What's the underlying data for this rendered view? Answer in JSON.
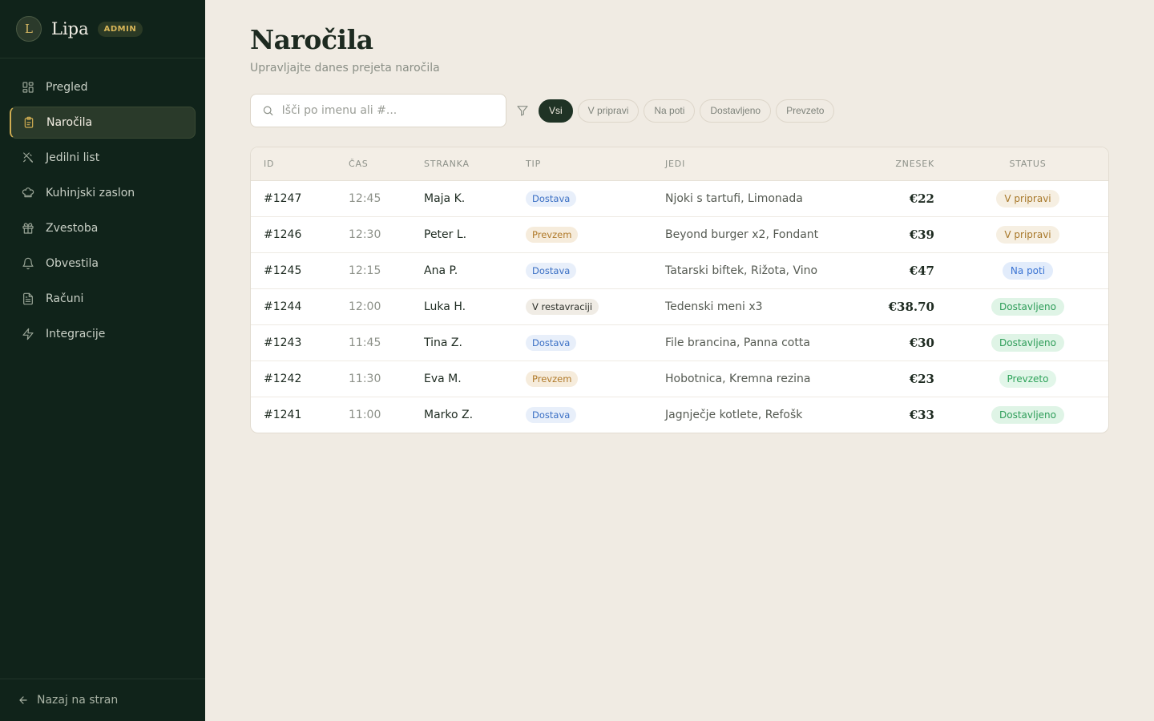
{
  "brand": {
    "initial": "L",
    "name": "Lipa",
    "badge": "ADMIN"
  },
  "nav": [
    {
      "label": "Pregled",
      "icon": "grid-icon",
      "active": false
    },
    {
      "label": "Naročila",
      "icon": "clipboard-icon",
      "active": true
    },
    {
      "label": "Jedilni list",
      "icon": "utensils-icon",
      "active": false
    },
    {
      "label": "Kuhinjski zaslon",
      "icon": "chef-hat-icon",
      "active": false
    },
    {
      "label": "Zvestoba",
      "icon": "gift-icon",
      "active": false
    },
    {
      "label": "Obvestila",
      "icon": "bell-icon",
      "active": false
    },
    {
      "label": "Računi",
      "icon": "receipt-icon",
      "active": false
    },
    {
      "label": "Integracije",
      "icon": "lightning-icon",
      "active": false
    }
  ],
  "footer": {
    "back_label": "Nazaj na stran"
  },
  "page": {
    "title": "Naročila",
    "subtitle": "Upravljajte danes prejeta naročila"
  },
  "search": {
    "placeholder": "Išči po imenu ali #...",
    "value": ""
  },
  "filters": [
    {
      "label": "Vsi",
      "active": true
    },
    {
      "label": "V pripravi",
      "active": false
    },
    {
      "label": "Na poti",
      "active": false
    },
    {
      "label": "Dostavljeno",
      "active": false
    },
    {
      "label": "Prevzeto",
      "active": false
    }
  ],
  "table": {
    "headers": {
      "id": "ID",
      "time": "ČAS",
      "customer": "STRANKA",
      "type": "TIP",
      "items": "JEDI",
      "amount": "ZNESEK",
      "status": "STATUS"
    },
    "rows": [
      {
        "id": "#1247",
        "time": "12:45",
        "customer": "Maja K.",
        "type": "Dostava",
        "type_key": "dostava",
        "items": "Njoki s tartufi, Limonada",
        "amount": "€22",
        "status": "V pripravi",
        "status_key": "priprava"
      },
      {
        "id": "#1246",
        "time": "12:30",
        "customer": "Peter L.",
        "type": "Prevzem",
        "type_key": "prevzem",
        "items": "Beyond burger x2, Fondant",
        "amount": "€39",
        "status": "V pripravi",
        "status_key": "priprava"
      },
      {
        "id": "#1245",
        "time": "12:15",
        "customer": "Ana P.",
        "type": "Dostava",
        "type_key": "dostava",
        "items": "Tatarski biftek, Rižota, Vino",
        "amount": "€47",
        "status": "Na poti",
        "status_key": "poti"
      },
      {
        "id": "#1244",
        "time": "12:00",
        "customer": "Luka H.",
        "type": "V restavraciji",
        "type_key": "restavracija",
        "items": "Tedenski meni x3",
        "amount": "€38.70",
        "status": "Dostavljeno",
        "status_key": "dostavljeno"
      },
      {
        "id": "#1243",
        "time": "11:45",
        "customer": "Tina Z.",
        "type": "Dostava",
        "type_key": "dostava",
        "items": "File brancina, Panna cotta",
        "amount": "€30",
        "status": "Dostavljeno",
        "status_key": "dostavljeno"
      },
      {
        "id": "#1242",
        "time": "11:30",
        "customer": "Eva M.",
        "type": "Prevzem",
        "type_key": "prevzem",
        "items": "Hobotnica, Kremna rezina",
        "amount": "€23",
        "status": "Prevzeto",
        "status_key": "prevzeto"
      },
      {
        "id": "#1241",
        "time": "11:00",
        "customer": "Marko Z.",
        "type": "Dostava",
        "type_key": "dostava",
        "items": "Jagnječje kotlete, Refošk",
        "amount": "€33",
        "status": "Dostavljeno",
        "status_key": "dostavljeno"
      }
    ]
  },
  "colors": {
    "sidebar_bg": "#10231a",
    "accent_gold": "#d0ad52",
    "page_bg": "#f0ebe3"
  }
}
